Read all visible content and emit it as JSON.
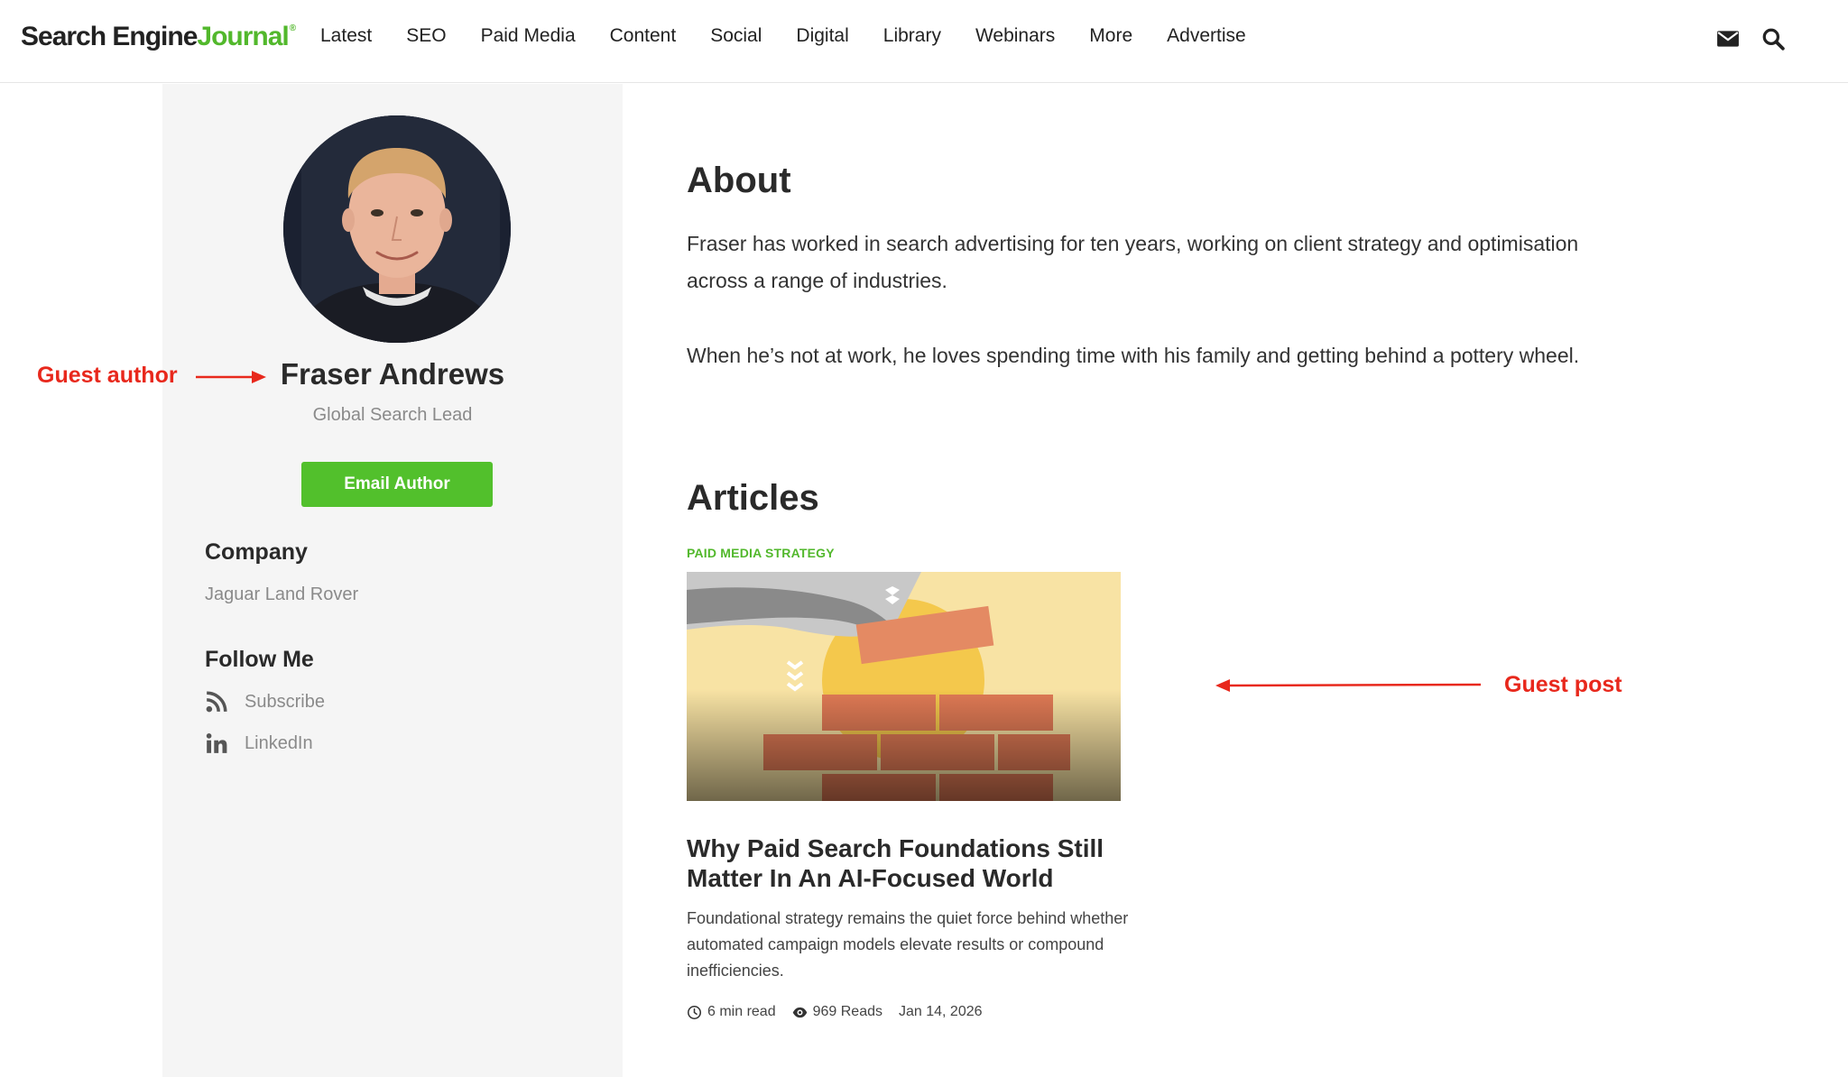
{
  "header": {
    "logo_part1": "Search Engine",
    "logo_part2": "Journal",
    "logo_mark": "®",
    "nav": [
      "Latest",
      "SEO",
      "Paid Media",
      "Content",
      "Social",
      "Digital",
      "Library",
      "Webinars",
      "More",
      "Advertise"
    ],
    "icons": [
      "envelope-icon",
      "search-icon"
    ]
  },
  "sidebar": {
    "name": "Fraser Andrews",
    "role": "Global Search Lead",
    "email_button": "Email Author",
    "company_heading": "Company",
    "company": "Jaguar Land Rover",
    "follow_heading": "Follow Me",
    "follow_links": [
      {
        "label": "Subscribe",
        "icon": "rss-icon"
      },
      {
        "label": "LinkedIn",
        "icon": "linkedin-icon"
      }
    ]
  },
  "annotations": {
    "author": "Guest author",
    "post": "Guest post",
    "color": "#e8281c"
  },
  "main": {
    "about_heading": "About",
    "about_paragraphs": [
      "Fraser has worked in search advertising for ten years, working on client strategy and optimisation across a range of industries.",
      "When he’s not at work, he loves spending time with his family and getting behind a pottery wheel."
    ],
    "articles_heading": "Articles",
    "article": {
      "category": "PAID MEDIA STRATEGY",
      "title": "Why Paid Search Foundations Still Matter In An AI-Focused World",
      "excerpt": "Foundational strategy remains the quiet force behind whether automated campaign models elevate results or compound inefficiencies.",
      "read_time": "6 min read",
      "reads": "969 Reads",
      "date": "Jan 14, 2026"
    }
  },
  "colors": {
    "brand_green": "#52b82c",
    "button_green": "#52c02c",
    "sidebar_bg": "#f5f5f5"
  }
}
